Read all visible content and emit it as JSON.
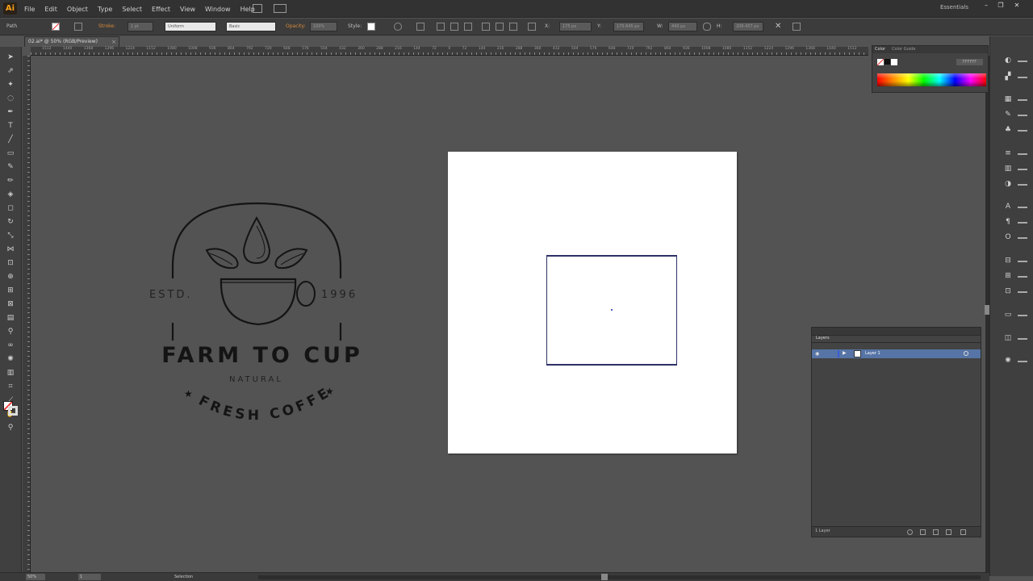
{
  "app": {
    "logo": "Ai",
    "workspace": "Essentials"
  },
  "menu": [
    "File",
    "Edit",
    "Object",
    "Type",
    "Select",
    "Effect",
    "View",
    "Window",
    "Help"
  ],
  "control_bar": {
    "selection_type": "Path",
    "stroke_label": "Stroke:",
    "stroke_weight": "1 pt",
    "profile": "Uniform",
    "brush": "Basic",
    "opacity_label": "Opacity:",
    "opacity": "100%",
    "style_label": "Style:",
    "x_label": "X:",
    "x_value": "175 px",
    "y_label": "Y:",
    "y_value": "175.645 px",
    "w_label": "W:",
    "w_value": "440 px",
    "h_label": "H:",
    "h_value": "206.457 px"
  },
  "document": {
    "tab_title": "02.ai* @ 50% (RGB/Preview)",
    "close_glyph": "×"
  },
  "rulers": {
    "horizontal_ticks": [
      "1512",
      "1440",
      "1368",
      "1296",
      "1224",
      "1152",
      "1080",
      "1008",
      "936",
      "864",
      "792",
      "720",
      "648",
      "576",
      "504",
      "432",
      "360",
      "288",
      "216",
      "144",
      "72",
      "0",
      "72",
      "144",
      "216",
      "288",
      "360",
      "432",
      "504",
      "576",
      "648",
      "720",
      "792",
      "864",
      "936",
      "1008",
      "1080",
      "1152",
      "1224",
      "1296",
      "1368",
      "1440",
      "1512"
    ]
  },
  "tools": [
    {
      "name": "selection-tool",
      "glyph": "➤"
    },
    {
      "name": "direct-selection-tool",
      "glyph": "⇗"
    },
    {
      "name": "magic-wand-tool",
      "glyph": "✦"
    },
    {
      "name": "lasso-tool",
      "glyph": "◌"
    },
    {
      "name": "pen-tool",
      "glyph": "✒"
    },
    {
      "name": "type-tool",
      "glyph": "T"
    },
    {
      "name": "line-tool",
      "glyph": "╱"
    },
    {
      "name": "rectangle-tool",
      "glyph": "▭"
    },
    {
      "name": "paintbrush-tool",
      "glyph": "✎"
    },
    {
      "name": "pencil-tool",
      "glyph": "✏"
    },
    {
      "name": "blob-brush-tool",
      "glyph": "◈"
    },
    {
      "name": "eraser-tool",
      "glyph": "◻"
    },
    {
      "name": "rotate-tool",
      "glyph": "↻"
    },
    {
      "name": "scale-tool",
      "glyph": "⤡"
    },
    {
      "name": "width-tool",
      "glyph": "⋈"
    },
    {
      "name": "free-transform-tool",
      "glyph": "⊡"
    },
    {
      "name": "shape-builder-tool",
      "glyph": "⊕"
    },
    {
      "name": "perspective-grid-tool",
      "glyph": "⊞"
    },
    {
      "name": "mesh-tool",
      "glyph": "⊠"
    },
    {
      "name": "gradient-tool",
      "glyph": "▤"
    },
    {
      "name": "eyedropper-tool",
      "glyph": "⚲"
    },
    {
      "name": "blend-tool",
      "glyph": "∞"
    },
    {
      "name": "symbol-sprayer-tool",
      "glyph": "✺"
    },
    {
      "name": "column-graph-tool",
      "glyph": "▥"
    },
    {
      "name": "artboard-tool",
      "glyph": "⌗"
    },
    {
      "name": "slice-tool",
      "glyph": "⟋"
    },
    {
      "name": "hand-tool",
      "glyph": "✋"
    },
    {
      "name": "zoom-tool",
      "glyph": "⚲"
    }
  ],
  "color_panel": {
    "tab_color": "Color",
    "tab_guide": "Color Guide",
    "hex": "FFFFFF"
  },
  "logo": {
    "estd": "ESTD.",
    "year": "1996",
    "title": "FARM TO CUP",
    "subtitle": "NATURAL",
    "arc_text": "FRESH COFFEE",
    "star": "★"
  },
  "layers_panel": {
    "title": "Layers",
    "layer_name": "Layer 1",
    "count": "1 Layer",
    "eye": "◉",
    "arrow": "▶",
    "highlight_color": "#5674a5",
    "layer_color": "#3c5bd6"
  },
  "status_bar": {
    "zoom": "50%",
    "artboard": "1",
    "tool": "Selection"
  },
  "colors": {
    "accent": "#f7a21b",
    "selection": "#2e3166",
    "workspace_bg": "#535353"
  }
}
